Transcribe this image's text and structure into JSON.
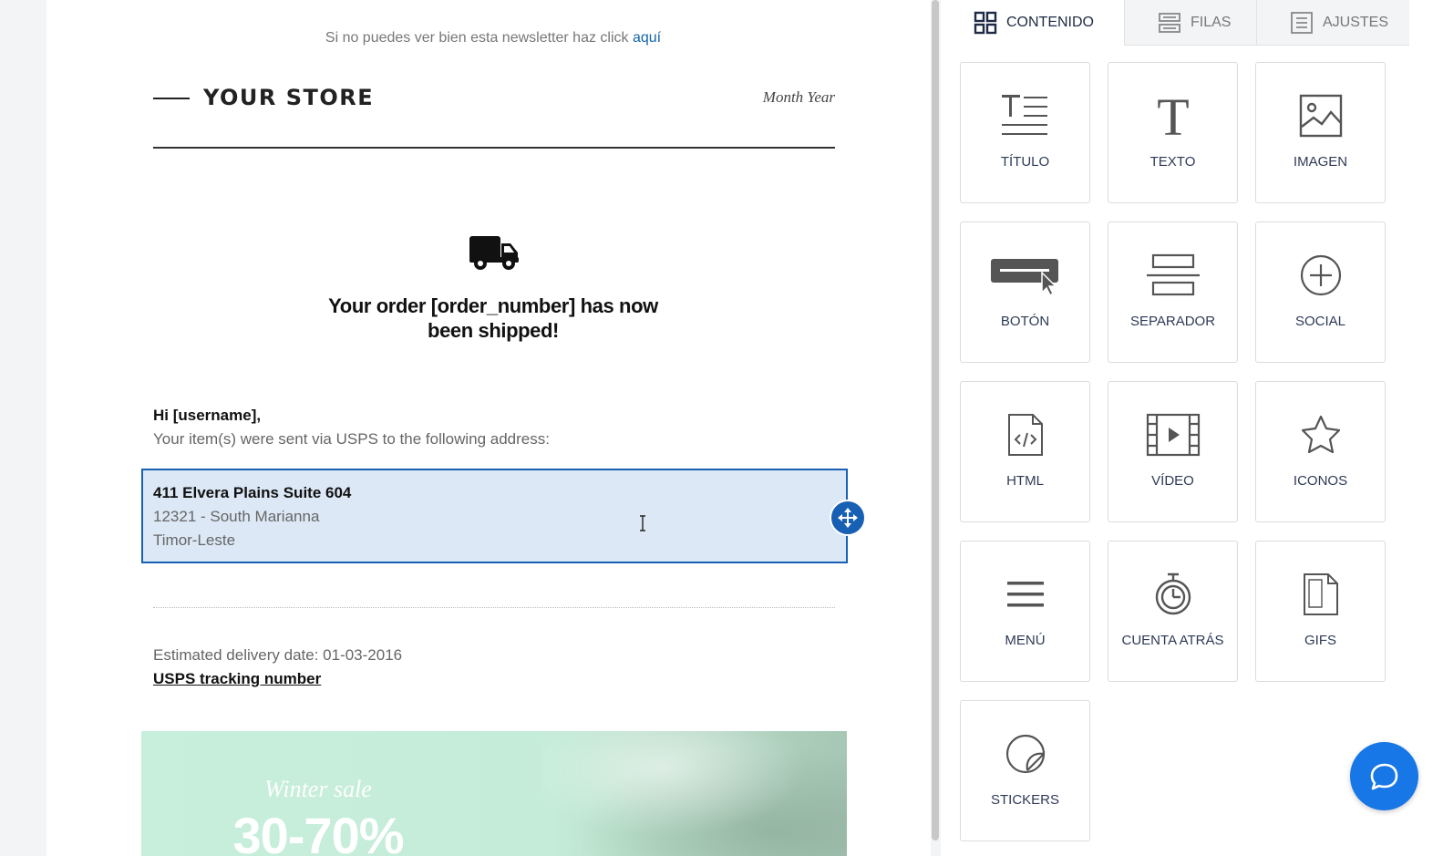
{
  "email": {
    "view_online_text": "Si no puedes ver bien esta newsletter haz click",
    "view_online_link": "aquí",
    "store_name": "YOUR STORE",
    "month_year": "Month Year",
    "ship_title": "Your order [order_number] has now been shipped!",
    "greeting": "Hi [username],",
    "sent_line": "Your item(s) were sent via USPS to the following address:",
    "address": {
      "line1": "411 Elvera Plains Suite 604",
      "line2": "12321 - South Marianna",
      "line3": "Timor-Leste"
    },
    "delivery_line": "Estimated delivery date: 01-03-2016",
    "tracking_link": "USPS tracking number",
    "banner": {
      "subtitle": "Winter sale",
      "headline": "30-70%"
    }
  },
  "panel": {
    "tabs": [
      {
        "label": "CONTENIDO",
        "icon": "grid-icon",
        "active": true
      },
      {
        "label": "FILAS",
        "icon": "rows-icon",
        "active": false
      },
      {
        "label": "AJUSTES",
        "icon": "settings-list-icon",
        "active": false
      }
    ],
    "blocks": [
      {
        "label": "TÍTULO",
        "icon": "title-icon"
      },
      {
        "label": "TEXTO",
        "icon": "text-icon"
      },
      {
        "label": "IMAGEN",
        "icon": "image-icon"
      },
      {
        "label": "BOTÓN",
        "icon": "button-icon"
      },
      {
        "label": "SEPARADOR",
        "icon": "divider-icon"
      },
      {
        "label": "SOCIAL",
        "icon": "social-plus-icon"
      },
      {
        "label": "HTML",
        "icon": "html-file-icon"
      },
      {
        "label": "VÍDEO",
        "icon": "video-icon"
      },
      {
        "label": "ICONOS",
        "icon": "star-icon"
      },
      {
        "label": "MENÚ",
        "icon": "menu-icon"
      },
      {
        "label": "CUENTA ATRÁS",
        "icon": "stopwatch-icon"
      },
      {
        "label": "GIFS",
        "icon": "gif-file-icon"
      },
      {
        "label": "STICKERS",
        "icon": "sticker-icon"
      }
    ]
  },
  "colors": {
    "accent": "#1760b4",
    "selection_bg": "#dce8f5",
    "chat": "#1877e6",
    "panel_text": "#2e3a56"
  }
}
